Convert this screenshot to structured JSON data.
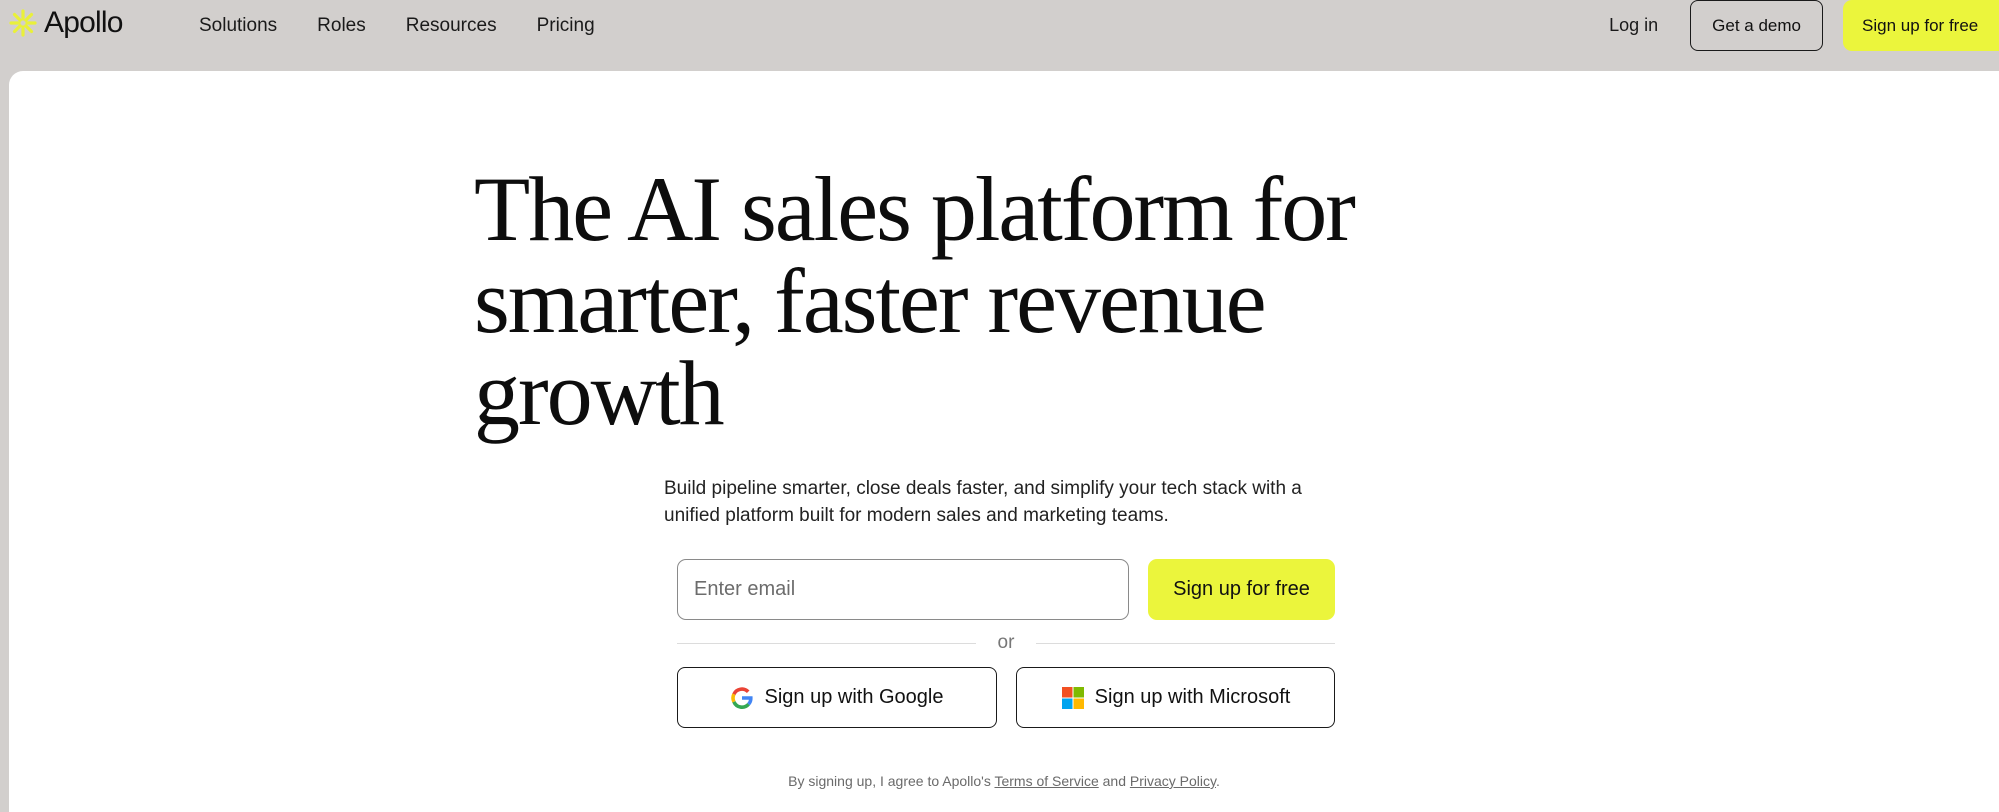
{
  "brand": {
    "name": "Apollo",
    "accent_color": "#ebf53c"
  },
  "nav": {
    "links": [
      "Solutions",
      "Roles",
      "Resources",
      "Pricing"
    ],
    "login_label": "Log in",
    "demo_label": "Get a demo",
    "signup_label": "Sign up for free"
  },
  "hero": {
    "headline": "The AI sales platform for smarter, faster revenue growth",
    "subheadline": "Build pipeline smarter, close deals faster, and simplify your tech stack with a unified platform built for modern sales and marketing teams.",
    "email_placeholder": "Enter email",
    "signup_label": "Sign up for free",
    "divider_text": "or",
    "google_label": "Sign up with Google",
    "microsoft_label": "Sign up with Microsoft"
  },
  "legal": {
    "prefix": "By signing up, I agree to Apollo's",
    "terms": "Terms of Service",
    "and": "and",
    "privacy": "Privacy Policy",
    "suffix": "."
  }
}
